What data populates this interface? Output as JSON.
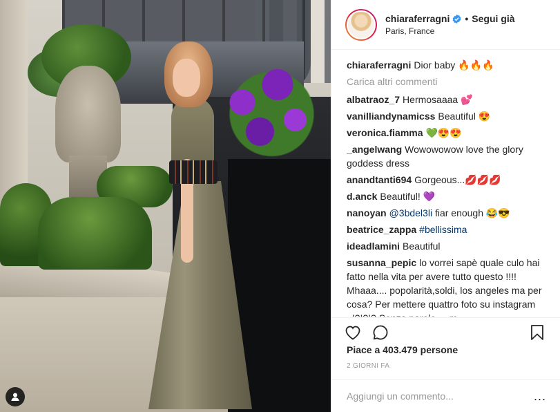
{
  "post": {
    "username": "chiaraferragni",
    "verified": true,
    "follow_label": "Segui già",
    "separator": "•",
    "location": "Paris, France",
    "caption_user": "chiaraferragni",
    "caption_text": "Dior baby 🔥🔥🔥"
  },
  "comments": {
    "load_more": "Carica altri commenti",
    "items": [
      {
        "user": "albatraoz_7",
        "text": "Hermosaaaa 💕"
      },
      {
        "user": "vanilliandynamicss",
        "text": "Beautiful 😍"
      },
      {
        "user": "veronica.fiamma",
        "text": "💚😍😍"
      },
      {
        "user": "_angelwang",
        "text": "Wowowowow love the glory goddess dress"
      },
      {
        "user": "anandtanti694",
        "text": "Gorgeous...💋💋💋"
      },
      {
        "user": "d.anck",
        "text": "Beautiful! 💜"
      },
      {
        "user": "nanoyan",
        "mention": "@3bdel3li",
        "text": "fiar enough 😂😎"
      },
      {
        "user": "beatrice_zappa",
        "mention": "#bellissima",
        "text": ""
      },
      {
        "user": "ideadlamini",
        "text": "Beautiful"
      },
      {
        "user": "susanna_pepic",
        "text": "lo vorrei sapè quale culo hai fatto nella vita per avere tutto questo !!!! Mhaaa.... popolarità,soldi, los angeles ma per cosa? Per mettere quattro foto su instagram ..!?!?!? Senza parole.... m"
      }
    ]
  },
  "actions": {
    "like_icon": "heart-icon",
    "comment_icon": "comment-icon",
    "save_icon": "bookmark-icon"
  },
  "likes_text": "Piace a 403.479 persone",
  "date_text": "2 GIORNI FA",
  "add_comment": {
    "placeholder": "Aggiungi un commento...",
    "more": "..."
  },
  "colors": {
    "verified_blue": "#3897f0",
    "text": "#262626",
    "muted": "#999999",
    "link": "#003569"
  }
}
